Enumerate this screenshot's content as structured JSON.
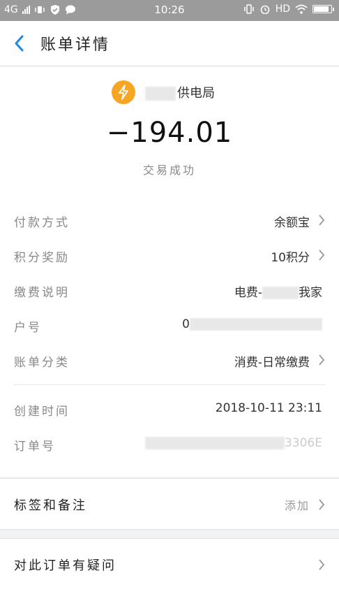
{
  "status_bar": {
    "network": "4G",
    "time": "10:26",
    "hd": "HD"
  },
  "header": {
    "title": "账单详情"
  },
  "summary": {
    "merchant_name": "供电局",
    "amount": "−194.01",
    "status": "交易成功",
    "accent_color": "#f6a623"
  },
  "details": {
    "rows": [
      {
        "label": "付款方式",
        "value": "余额宝"
      },
      {
        "label": "积分奖励",
        "value": "10积分"
      },
      {
        "label": "缴费说明",
        "value_prefix": "电费-",
        "value_suffix": "我家"
      },
      {
        "label": "户号",
        "value": "0"
      },
      {
        "label": "账单分类",
        "value": "消费-日常缴费"
      },
      {
        "label": "创建时间",
        "value": "2018-10-11 23:11"
      },
      {
        "label": "订单号",
        "value": "3306E"
      }
    ]
  },
  "tags_card": {
    "title": "标签和备注",
    "action": "添加"
  },
  "question_card": {
    "title": "对此订单有疑问"
  }
}
